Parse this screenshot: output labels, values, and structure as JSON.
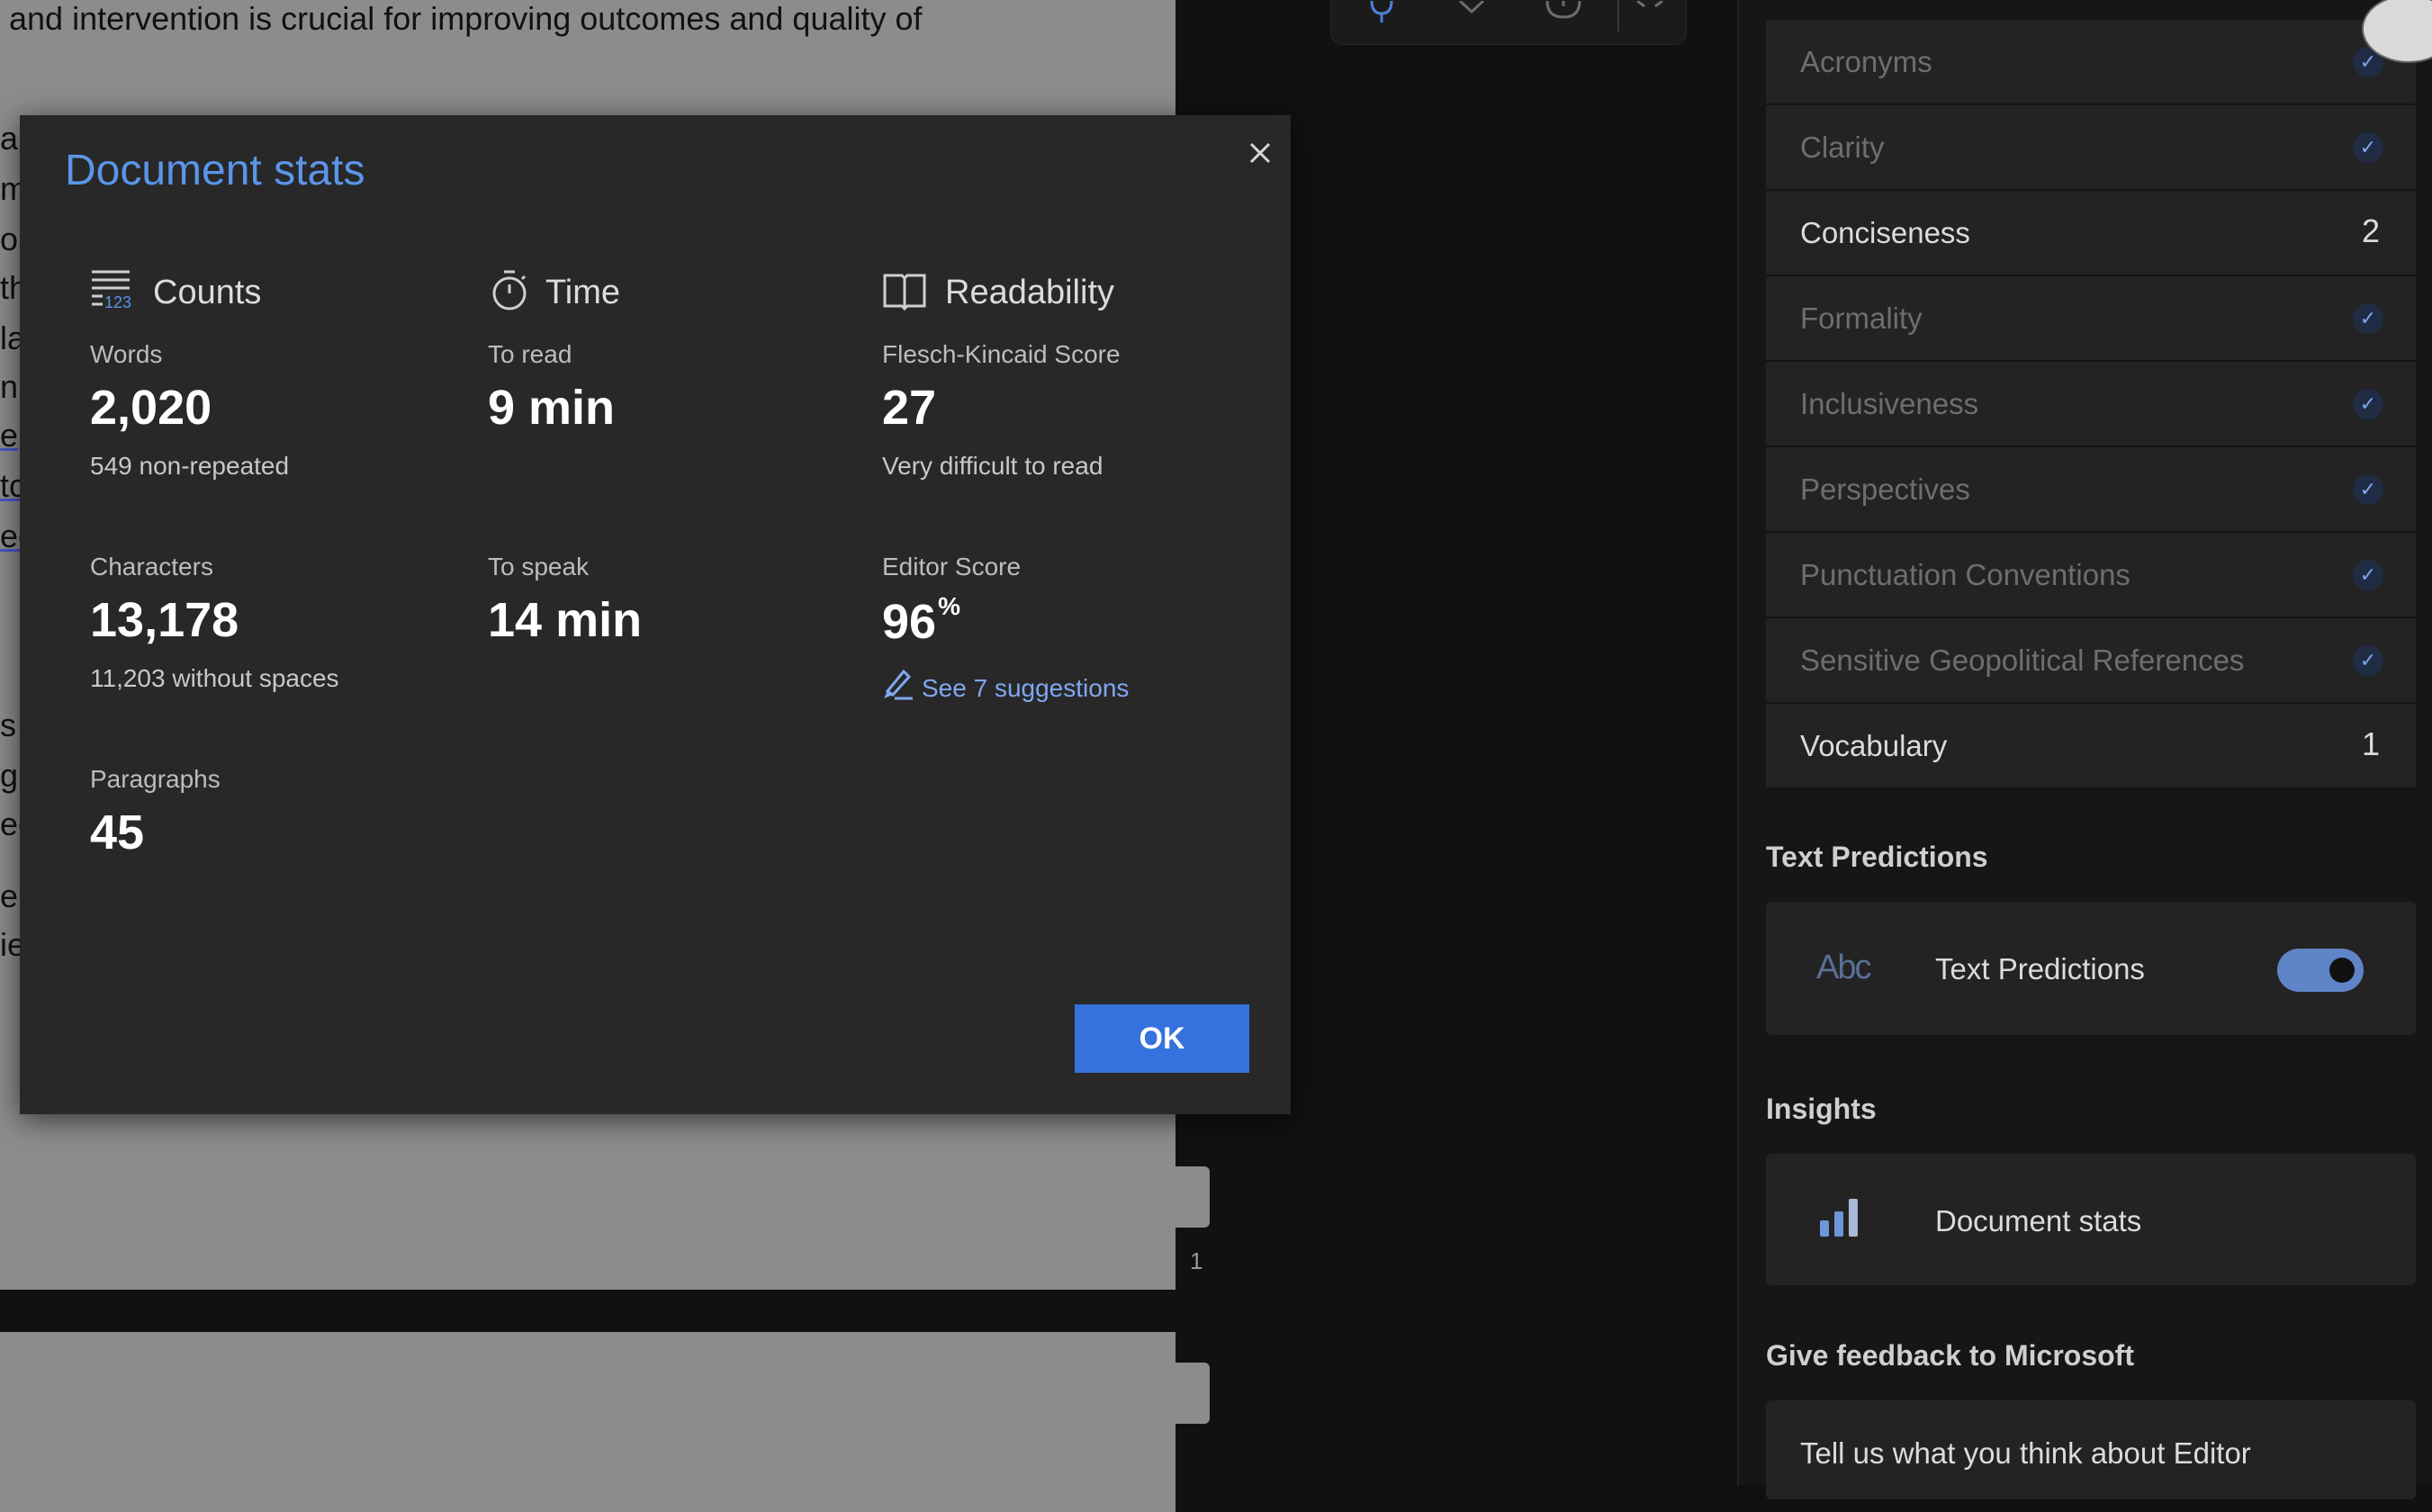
{
  "document": {
    "top_line": "and intervention is crucial for improving outcomes and quality of",
    "fragments": [
      "a",
      "m",
      "ol",
      "th",
      "la",
      "nic",
      "e",
      "tc",
      "ec",
      "s",
      "g",
      "ec",
      "ep",
      "ie"
    ],
    "page_number": "1"
  },
  "dialog": {
    "title": "Document stats",
    "ok_label": "OK",
    "counts": {
      "header": "Counts",
      "words_label": "Words",
      "words_value": "2,020",
      "words_sub": "549 non-repeated",
      "characters_label": "Characters",
      "characters_value": "13,178",
      "characters_sub": "11,203 without spaces",
      "paragraphs_label": "Paragraphs",
      "paragraphs_value": "45"
    },
    "time": {
      "header": "Time",
      "read_label": "To read",
      "read_value": "9 min",
      "speak_label": "To speak",
      "speak_value": "14 min"
    },
    "readability": {
      "header": "Readability",
      "fk_label": "Flesch-Kincaid Score",
      "fk_value": "27",
      "fk_sub": "Very difficult to read",
      "editor_label": "Editor Score",
      "editor_value": "96",
      "editor_unit": "%",
      "suggestions_link": "See 7 suggestions"
    }
  },
  "editor_pane": {
    "refinements": [
      {
        "label": "Acronyms",
        "status": "check"
      },
      {
        "label": "Clarity",
        "status": "check"
      },
      {
        "label": "Conciseness",
        "status": "count",
        "count": "2"
      },
      {
        "label": "Formality",
        "status": "check"
      },
      {
        "label": "Inclusiveness",
        "status": "check"
      },
      {
        "label": "Perspectives",
        "status": "check"
      },
      {
        "label": "Punctuation Conventions",
        "status": "check"
      },
      {
        "label": "Sensitive Geopolitical References",
        "status": "check"
      },
      {
        "label": "Vocabulary",
        "status": "count",
        "count": "1"
      }
    ],
    "text_predictions": {
      "section_title": "Text Predictions",
      "card_label": "Text Predictions",
      "icon_text": "Abc",
      "enabled": true
    },
    "insights": {
      "section_title": "Insights",
      "card_label": "Document stats"
    },
    "feedback": {
      "section_title": "Give feedback to Microsoft",
      "card_label": "Tell us what you think about Editor"
    }
  },
  "colors": {
    "accent": "#3572dd",
    "title_blue": "#5b95e8",
    "link_blue": "#7fa8f0",
    "dialog_bg": "#282828"
  }
}
